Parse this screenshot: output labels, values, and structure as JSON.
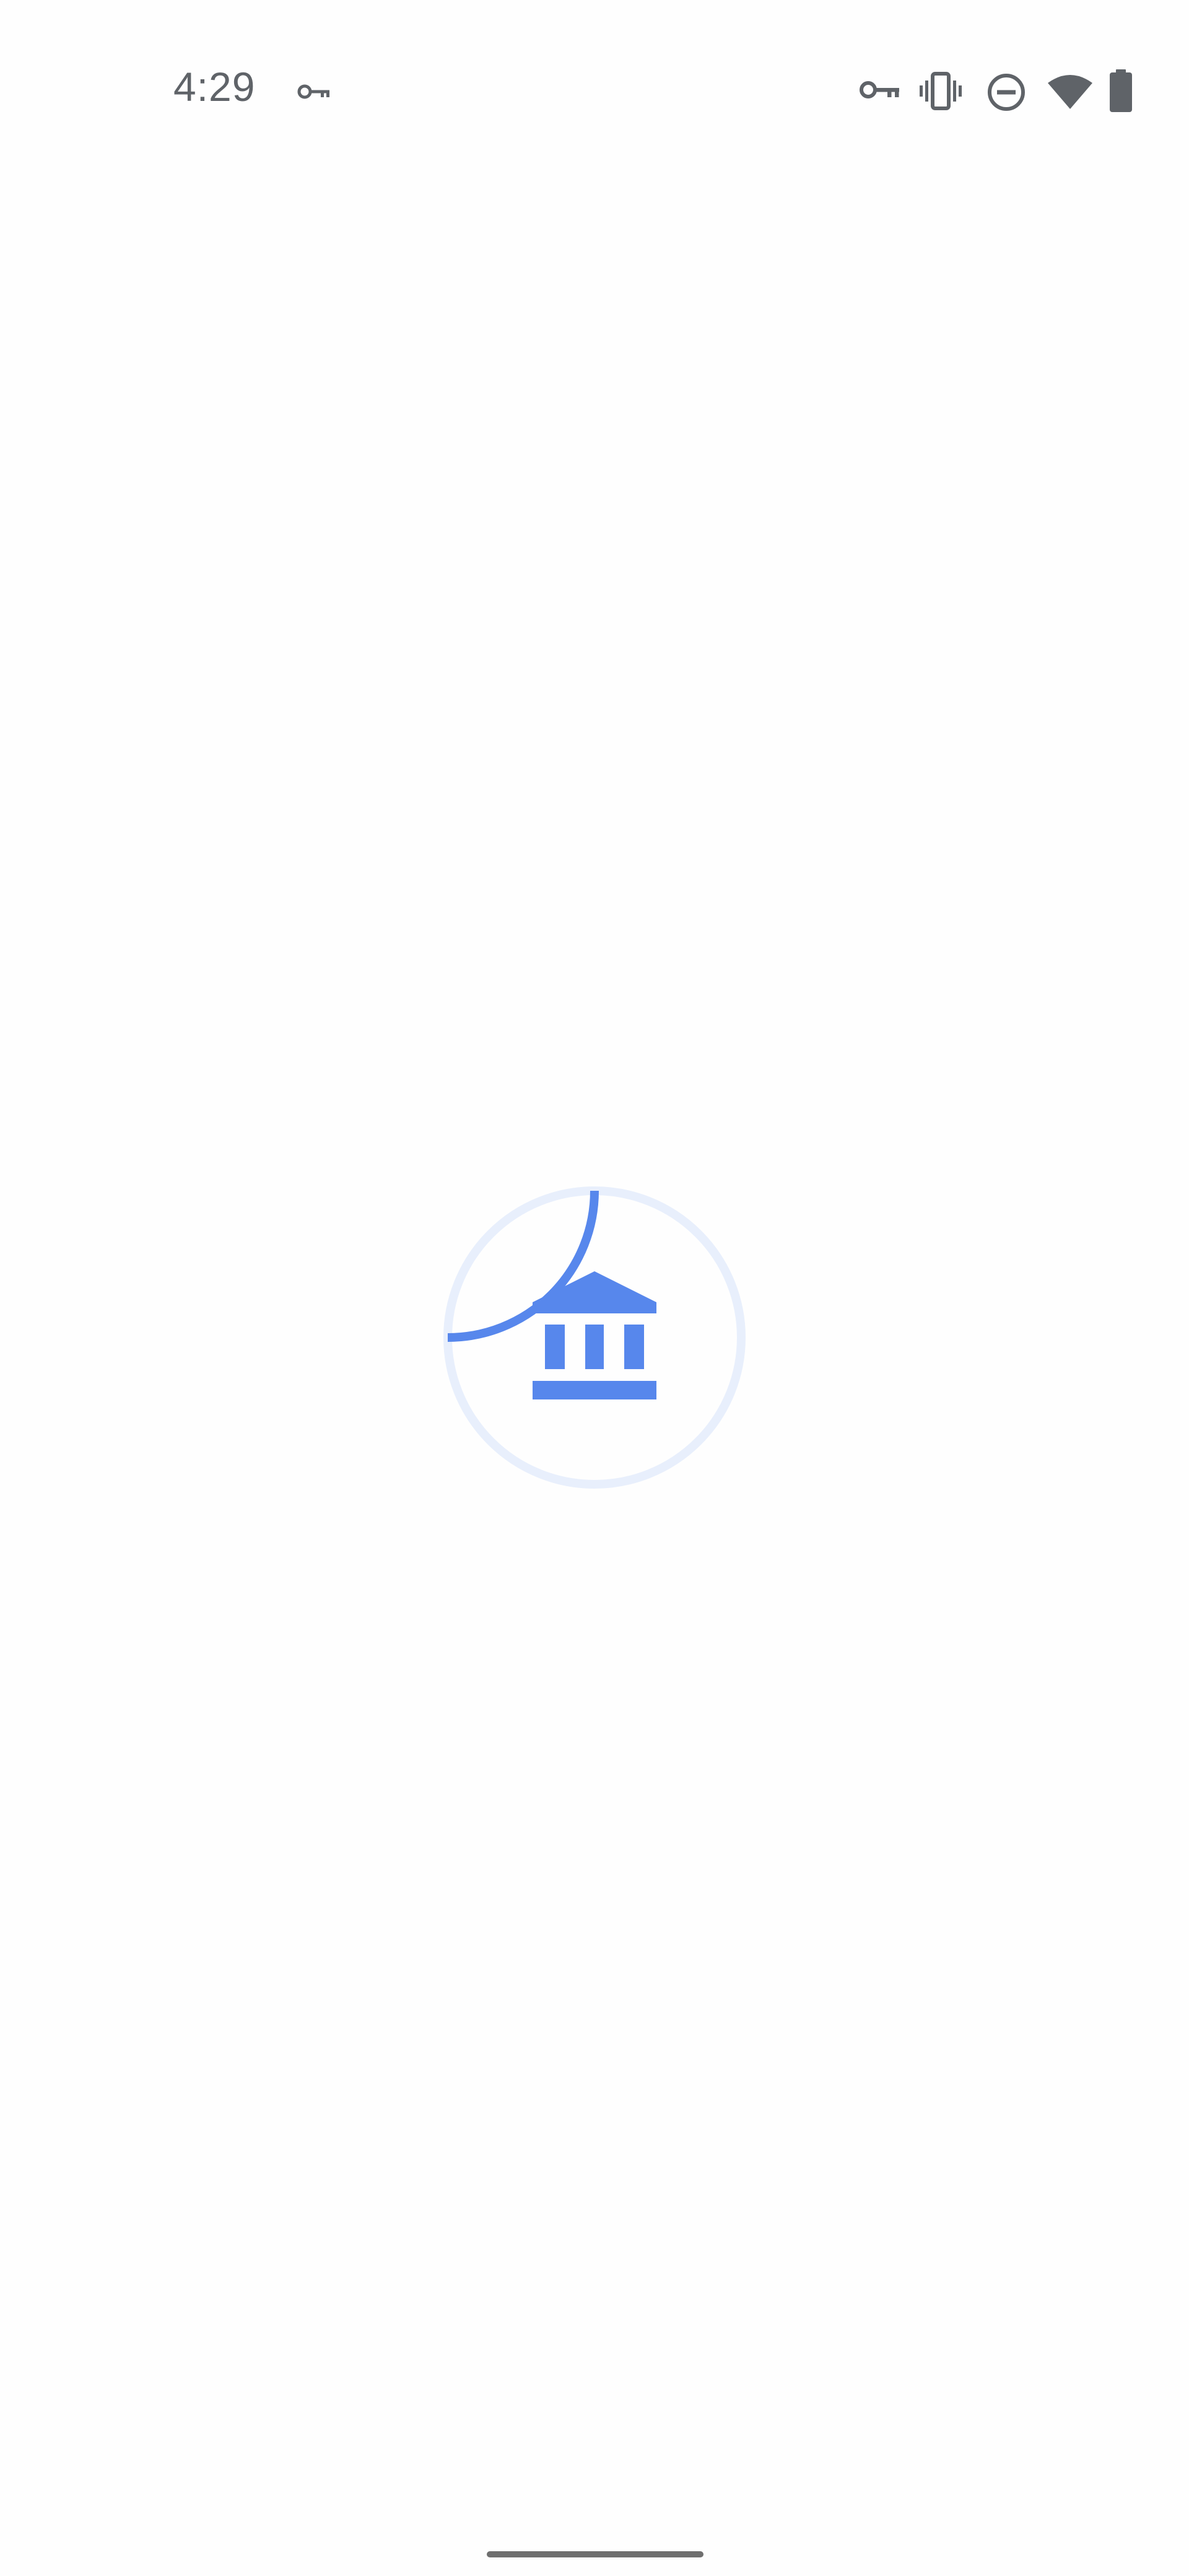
{
  "status_bar": {
    "time": "4:29",
    "icons": [
      "vpn-key-icon",
      "vpn-key-icon",
      "vibrate-icon",
      "do-not-disturb-icon",
      "wifi-icon",
      "battery-icon"
    ],
    "icon_color": "#5f6368"
  },
  "loading": {
    "icon": "bank-icon",
    "progress_fraction": 0.25,
    "accent_color": "#5787ec",
    "track_color": "#e8effc"
  },
  "nav_bar": {
    "handle_color": "#6f6f6f"
  }
}
